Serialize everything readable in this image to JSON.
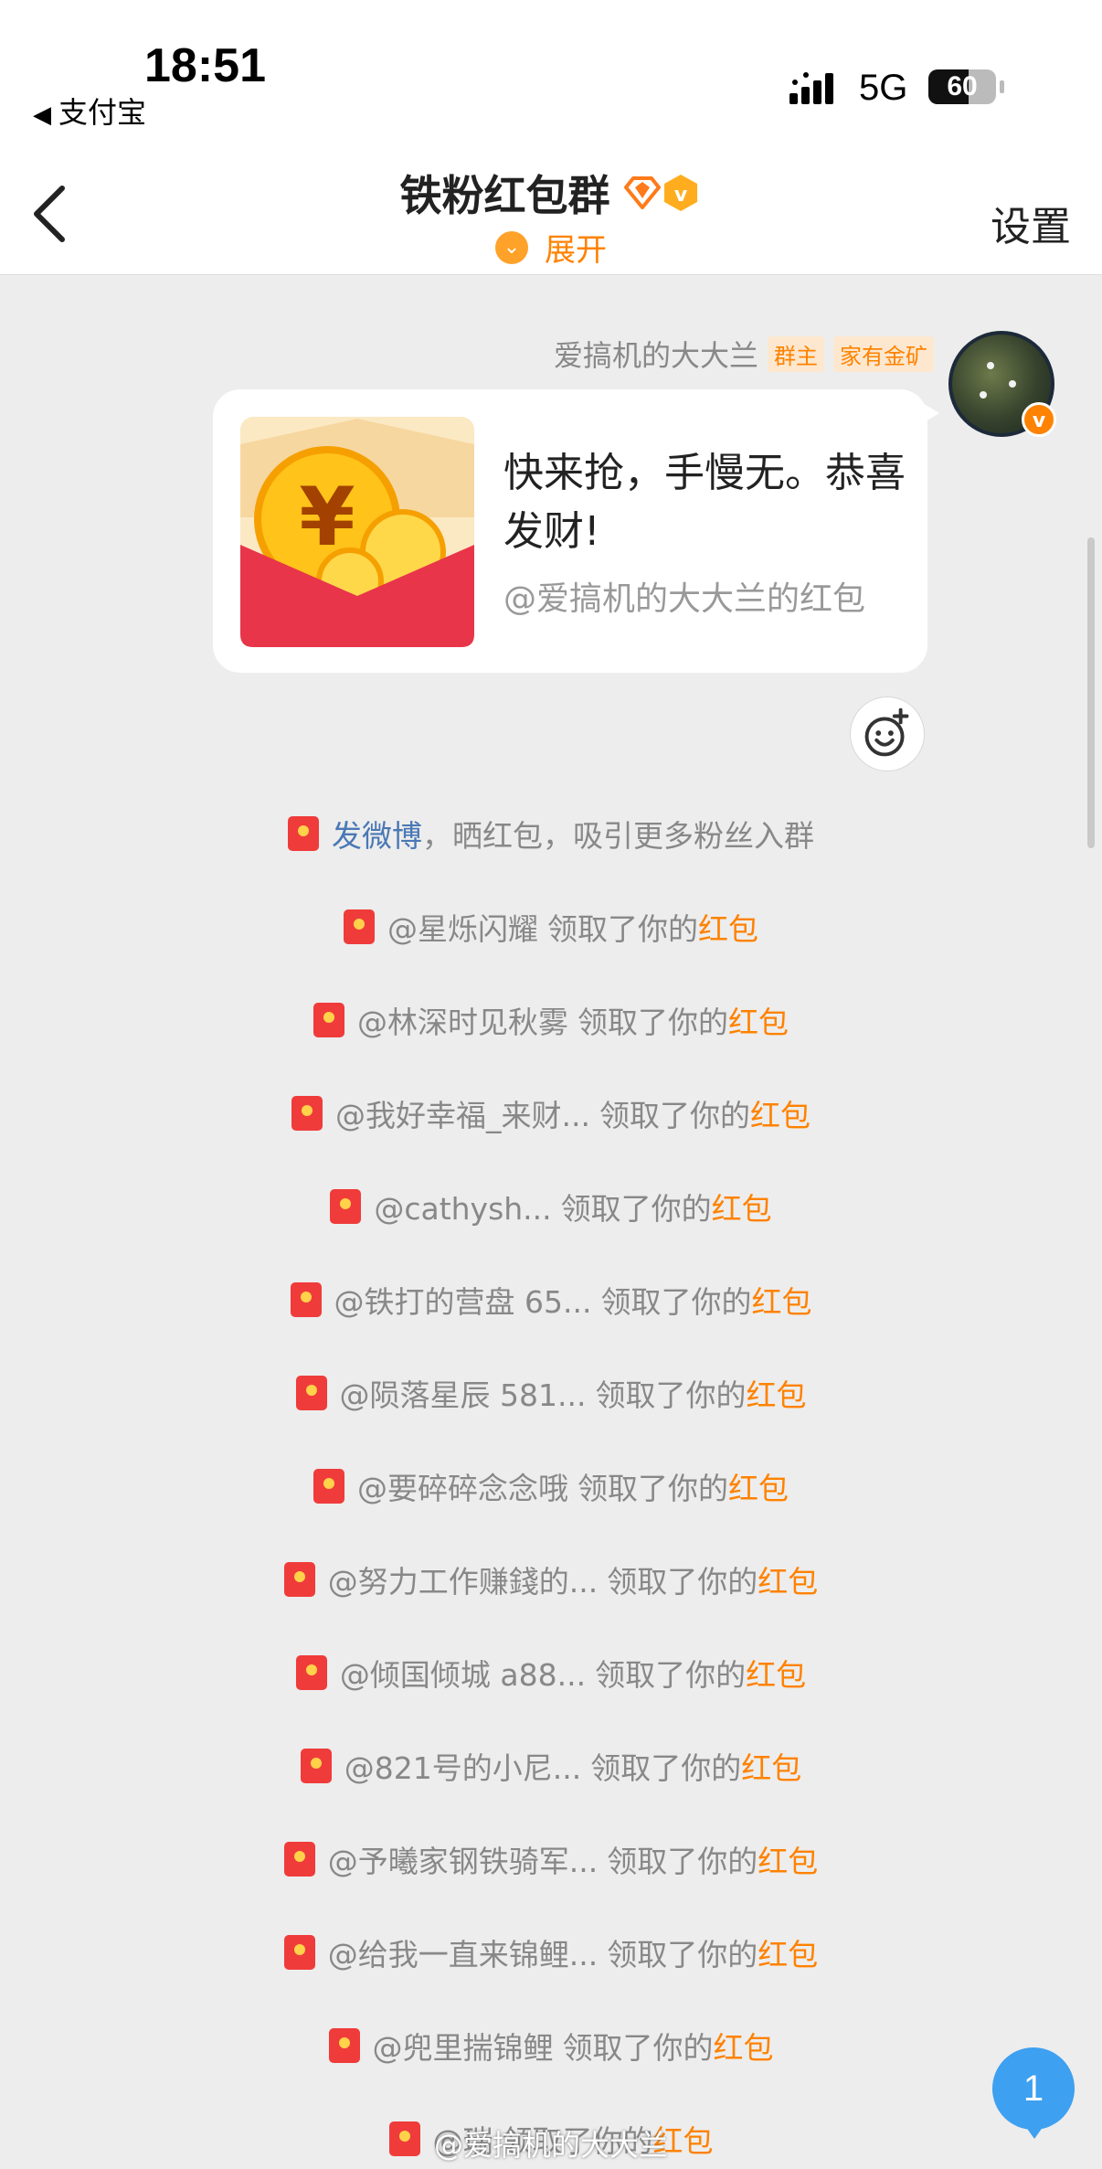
{
  "status_bar": {
    "time": "18:51",
    "back_app": "支付宝",
    "network": "5G",
    "battery": "60",
    "battery_level": 0.6
  },
  "header": {
    "title": "铁粉红包群",
    "expand_label": "展开",
    "settings_label": "设置"
  },
  "message": {
    "sender": "爱搞机的大大兰",
    "tags": [
      "群主",
      "家有金矿"
    ],
    "red_packet": {
      "title": "快来抢，手慢无。恭喜发财!",
      "from": "@爱搞机的大大兰的红包"
    }
  },
  "system_prompt": {
    "link": "发微博",
    "text": "，晒红包，吸引更多粉丝入群"
  },
  "claims": {
    "verb": "领取了你的",
    "item": "红包",
    "users": [
      "@星烁闪耀",
      "@林深时见秋雾",
      "@我好幸福_来财...",
      "@cathysh...",
      "@铁打的营盘 65...",
      "@陨落星辰 581...",
      "@要碎碎念念哦",
      "@努力工作赚錢的...",
      "@倾国倾城 a88...",
      "@821号的小尼...",
      "@予曦家钢铁骑军...",
      "@给我一直来锦鲤...",
      "@兜里揣锦鲤",
      "@瑞"
    ]
  },
  "unread_count": "1",
  "watermark": "@爱搞机的大大兰",
  "colors": {
    "accent": "#ff8200",
    "link": "#4a78b5",
    "red_packet": "#e8354a",
    "background": "#ededed"
  }
}
